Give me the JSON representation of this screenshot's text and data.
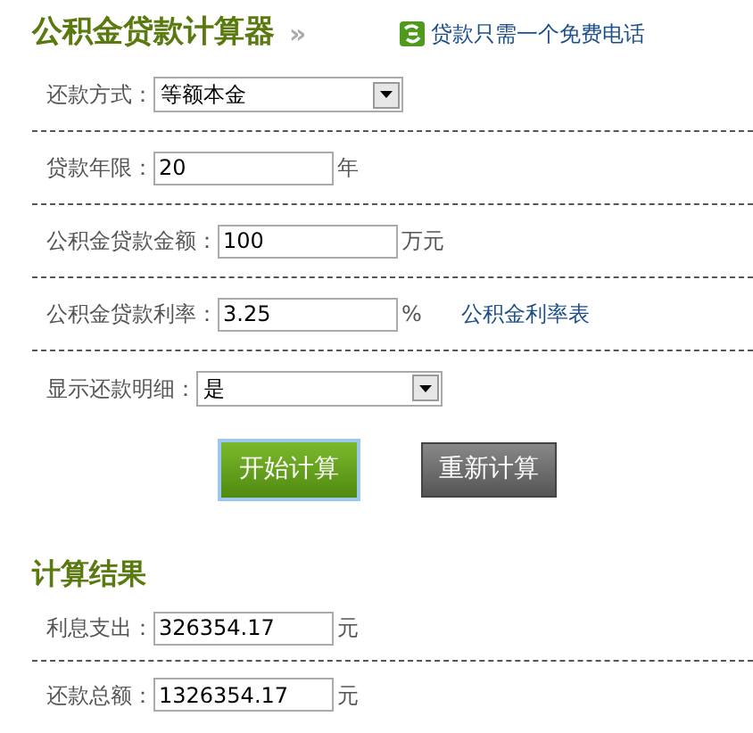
{
  "title": "公积金贷款计算器",
  "title_mark": "»",
  "promo": {
    "text": "贷款只需一个免费电话"
  },
  "fields": [
    {
      "kind": "select",
      "label": "还款方式：",
      "value": "等额本金"
    },
    {
      "kind": "input",
      "label": "贷款年限：",
      "value": "20",
      "unit": "年"
    },
    {
      "kind": "input",
      "label": "公积金贷款金额：",
      "value": "100",
      "unit": "万元"
    },
    {
      "kind": "input",
      "label": "公积金贷款利率：",
      "value": "3.25",
      "unit": "%",
      "link": "公积金利率表"
    },
    {
      "kind": "select",
      "label": "显示还款明细：",
      "value": "是"
    }
  ],
  "buttons": [
    {
      "label": "开始计算",
      "kind": "primary"
    },
    {
      "label": "重新计算",
      "kind": "secondary"
    }
  ],
  "results_title": "计算结果",
  "results": [
    {
      "label": "利息支出：",
      "value": "326354.17",
      "unit": "元"
    },
    {
      "label": "还款总额：",
      "value": "1326354.17",
      "unit": "元"
    }
  ]
}
